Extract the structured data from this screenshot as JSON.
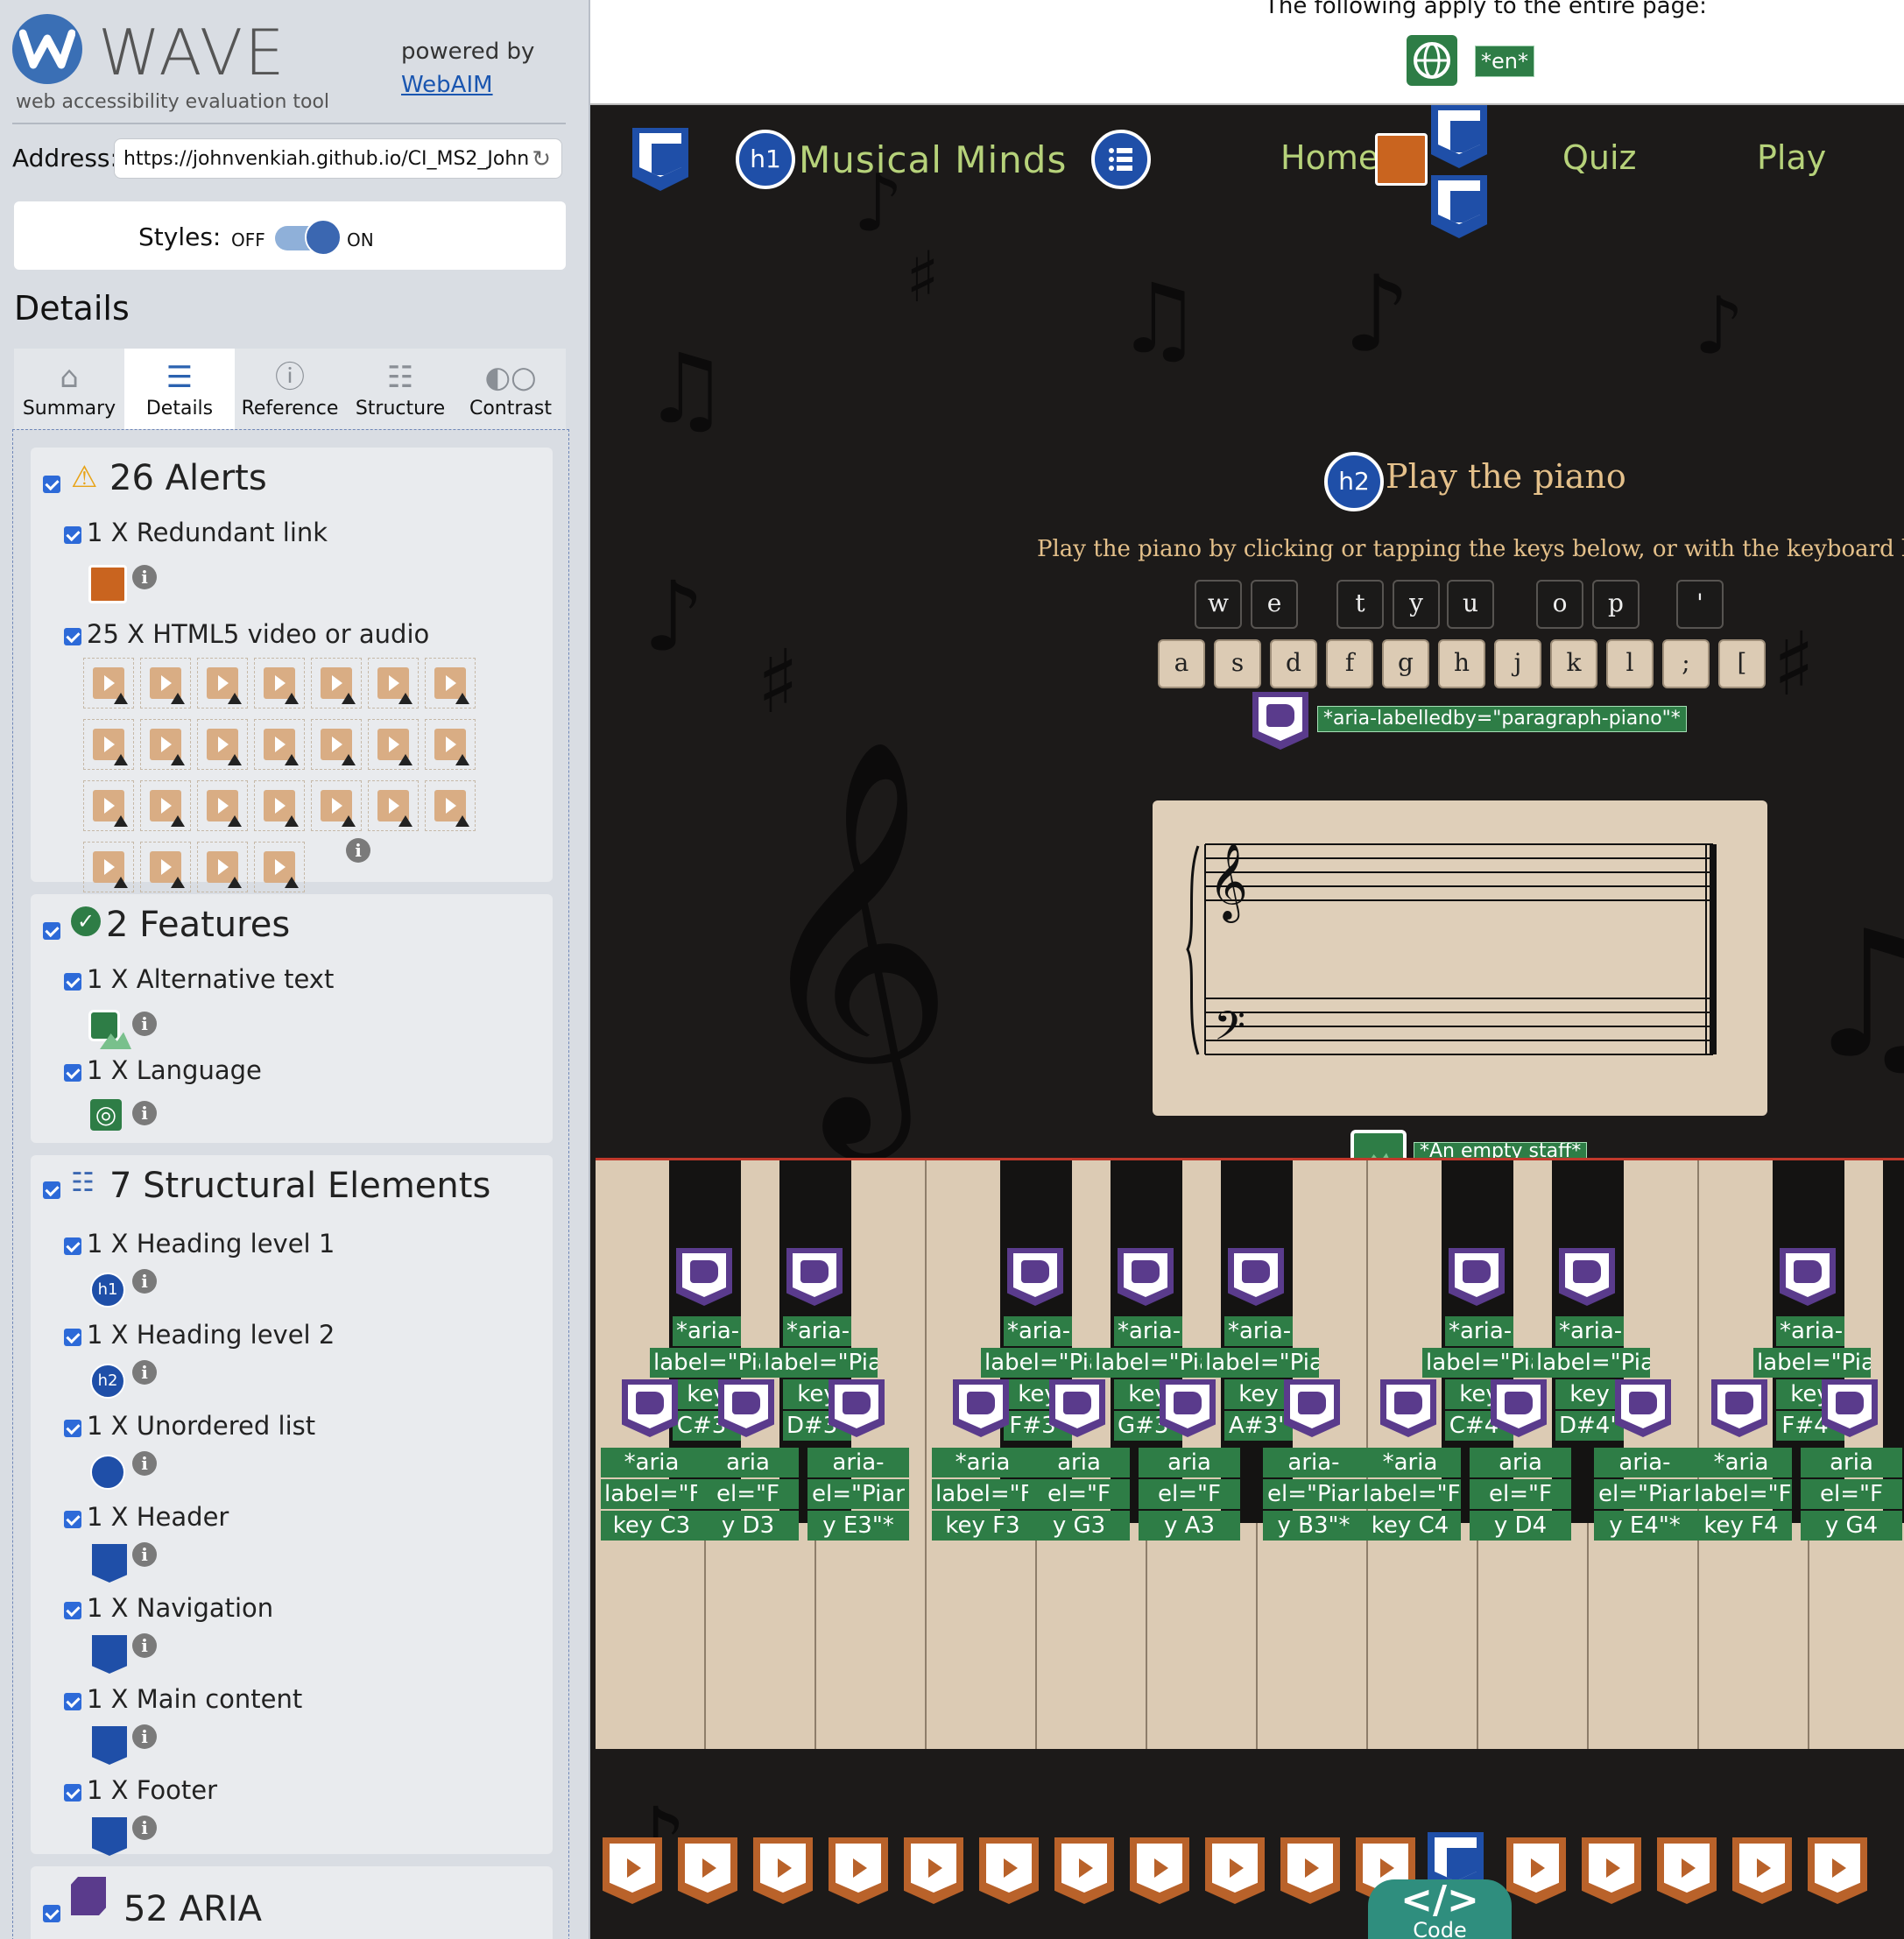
{
  "wave": {
    "title": "WAVE",
    "subtitle": "web accessibility evaluation tool",
    "powered_by": "powered by",
    "webaim": "WebAIM",
    "address_label": "Address:",
    "address_value": "https://johnvenkiah.github.io/CI_MS2_John",
    "styles_label": "Styles:",
    "styles_off": "OFF",
    "styles_on": "ON",
    "details_heading": "Details",
    "tabs": [
      "Summary",
      "Details",
      "Reference",
      "Structure",
      "Contrast"
    ],
    "alerts": {
      "title": "26 Alerts",
      "items": [
        "1 X Redundant link",
        "25 X HTML5 video or audio"
      ],
      "video_count": 25
    },
    "features": {
      "title": "2 Features",
      "items": [
        "1 X Alternative text",
        "1 X Language"
      ]
    },
    "structure": {
      "title": "7 Structural Elements",
      "items": [
        "1 X Heading level 1",
        "1 X Heading level 2",
        "1 X Unordered list",
        "1 X Header",
        "1 X Navigation",
        "1 X Main content",
        "1 X Footer"
      ]
    },
    "aria": {
      "title": "52 ARIA"
    },
    "info_glyph": "i"
  },
  "page": {
    "top_note": "The following apply to the entire page:",
    "lang_tag": "*en*",
    "site_title": "Musical Minds",
    "h1_badge": "h1",
    "h2_badge": "h2",
    "nav": [
      "Home",
      "Quiz",
      "Play"
    ],
    "heading": "Play the piano",
    "paragraph": "Play the piano by clicking or tapping the keys below, or with the keyboard keys:",
    "keys_top": [
      "w",
      "e",
      "t",
      "y",
      "u",
      "o",
      "p",
      "'"
    ],
    "keys_bottom": [
      "a",
      "s",
      "d",
      "f",
      "g",
      "h",
      "j",
      "k",
      "l",
      ";",
      "["
    ],
    "aria_labelledby": "*aria-labelledby=\"paragraph-piano\"*",
    "staff_alt": "*An empty staff*",
    "black_labels": [
      [
        "*aria-",
        "label=\"Pian",
        "key",
        "C#3\""
      ],
      [
        "*aria-",
        "label=\"Piano",
        "key",
        "D#3\"*"
      ],
      [
        "*aria-",
        "label=\"Pian",
        "key",
        "F#3\""
      ],
      [
        "*aria-",
        "label=\"Pian",
        "key",
        "G#3\""
      ],
      [
        "*aria-",
        "label=\"Piano",
        "key",
        "A#3\""
      ],
      [
        "*aria-",
        "label=\"Pian",
        "key",
        "C#4\""
      ],
      [
        "*aria-",
        "label=\"Piano",
        "key",
        "D#4\""
      ],
      [
        "*aria-",
        "label=\"Pianlab",
        "key",
        "F#4\""
      ]
    ],
    "white_labels": [
      [
        "*aria",
        "label=\"F",
        "key C3"
      ],
      [
        "aria",
        "el=\"F",
        "y D3"
      ],
      [
        "aria-",
        "el=\"Piar",
        "y E3\"*"
      ],
      [
        "*aria",
        "label=\"F",
        "key F3"
      ],
      [
        "aria",
        "el=\"F",
        "y G3"
      ],
      [
        "aria",
        "el=\"F",
        "y A3"
      ],
      [
        "aria-",
        "el=\"Piar",
        "y B3\"*"
      ],
      [
        "*aria",
        "label=\"F",
        "key C4"
      ],
      [
        "aria",
        "el=\"F",
        "y D4"
      ],
      [
        "aria-",
        "el=\"Piar",
        "y E4\"*"
      ],
      [
        "*aria",
        "label=\"F",
        "key F4"
      ],
      [
        "aria",
        "el=\"F",
        "y G4"
      ]
    ],
    "code_button": "</>",
    "code_label": "Code"
  },
  "colors": {
    "wave_blue": "#3b67b1",
    "aria_purple": "#5a3b8c",
    "feature_green": "#2e7d46",
    "alert_orange": "#c9641f",
    "nav_green": "#b6d27a",
    "serif_gold": "#e4c08a"
  }
}
